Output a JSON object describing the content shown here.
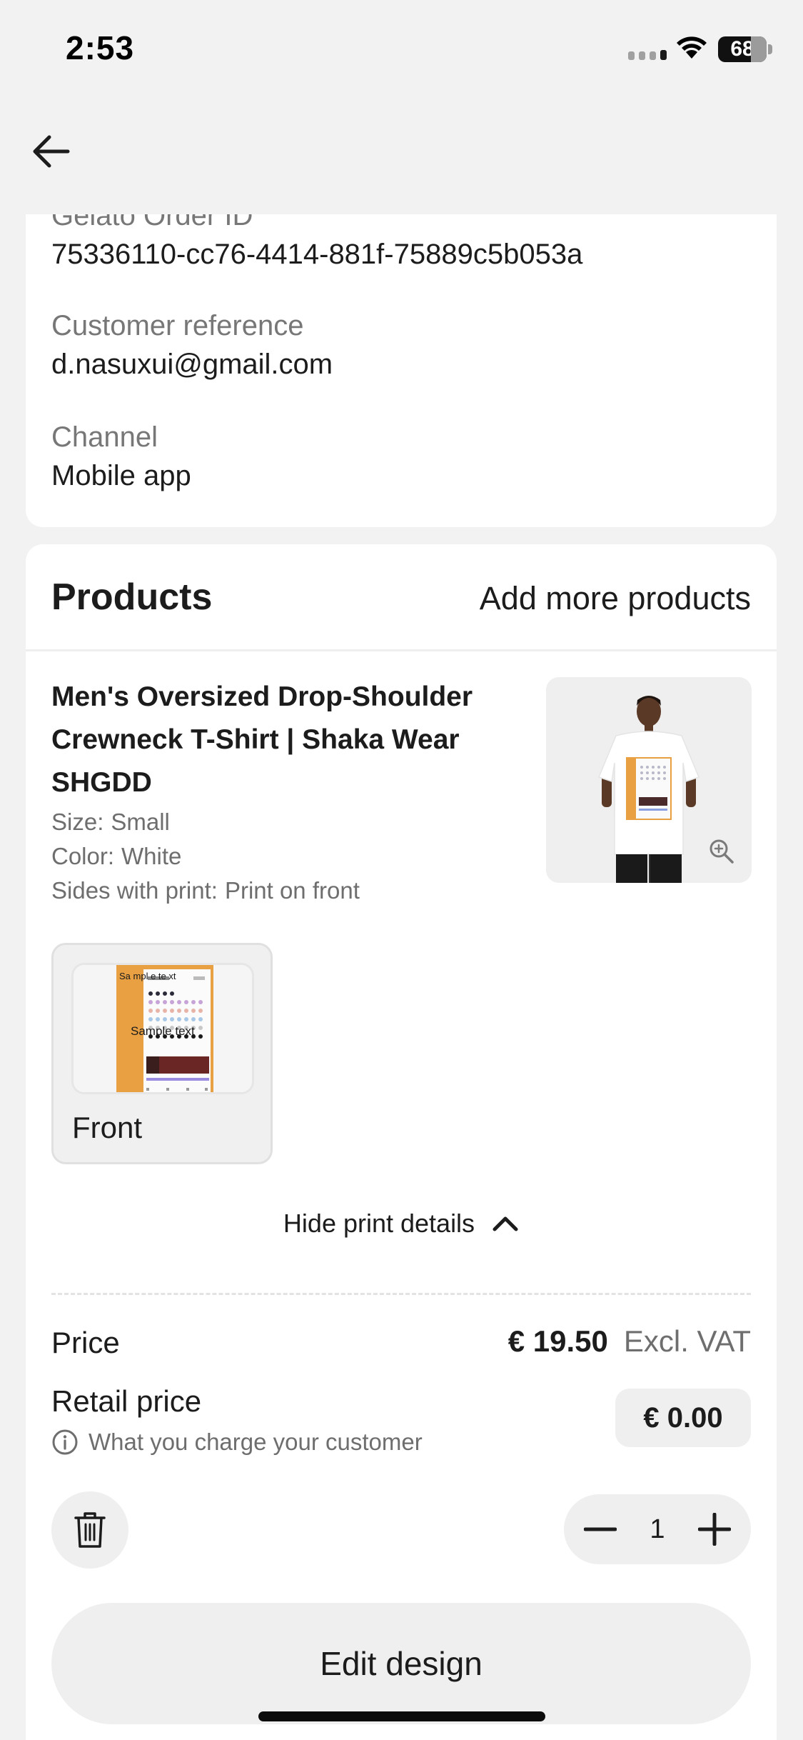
{
  "status_bar": {
    "time": "2:53",
    "battery": "68"
  },
  "order": {
    "order_id_label": "Gelato Order ID",
    "order_id_value": "75336110-cc76-4414-881f-75889c5b053a",
    "customer_reference_label": "Customer reference",
    "customer_reference_value": "d.nasuxui@gmail.com",
    "channel_label": "Channel",
    "channel_value": "Mobile app"
  },
  "products": {
    "title": "Products",
    "add_more_label": "Add more products",
    "item": {
      "name": "Men's Oversized Drop-Shoulder Crewneck T-Shirt | Shaka Wear SHGDD",
      "size_label": "Size:",
      "size_value": "Small",
      "color_label": "Color:",
      "color_value": "White",
      "sides_label": "Sides with print:",
      "sides_value": "Print on front",
      "print_side_label": "Front",
      "print_preview_text": "Sample text",
      "print_preview_side_text": "Sa mpl e te xt",
      "hide_details_label": "Hide print details",
      "price_label": "Price",
      "price_value": "€ 19.50",
      "price_vat": "Excl. VAT",
      "retail_label": "Retail price",
      "retail_hint": "What you charge your customer",
      "retail_value": "€ 0.00",
      "quantity": "1",
      "edit_design_label": "Edit design"
    }
  },
  "colors": {
    "background": "#f2f2f2",
    "card": "#ffffff",
    "pill": "#efefef",
    "print_orange": "#e8a043"
  }
}
